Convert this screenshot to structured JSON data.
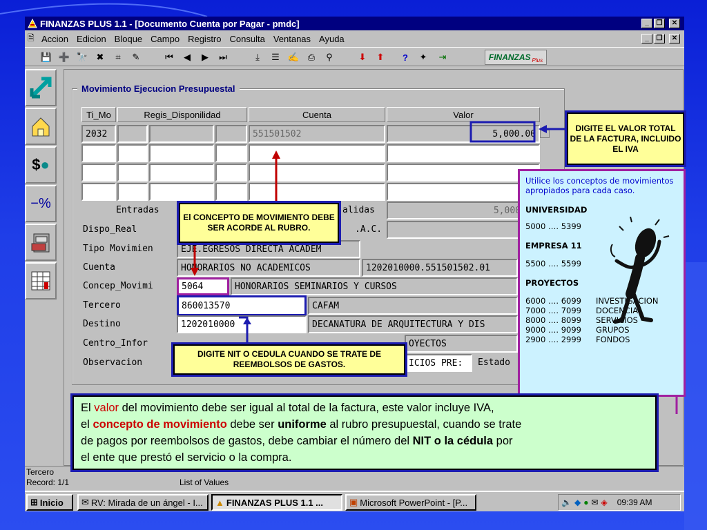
{
  "window": {
    "title": "FINANZAS PLUS 1.1 - [Documento Cuenta por Pagar - pmdc]",
    "menu": [
      "Accion",
      "Edicion",
      "Bloque",
      "Campo",
      "Registro",
      "Consulta",
      "Ventanas",
      "Ayuda"
    ],
    "logo": "FINANZAS",
    "logo_sub": "Plus"
  },
  "group_title": "Movimiento Ejecucion Presupuestal",
  "grid": {
    "headers": [
      "Ti_Mo",
      "Regis_Disponilidad",
      "Cuenta",
      "Valor"
    ],
    "row1": {
      "ti_mo": "2032",
      "cuenta": "551501502",
      "valor": "5,000.00"
    }
  },
  "form": {
    "entradas_label": "Entradas",
    "salidas_label": "alidas",
    "salidas_value": "5,000",
    "dispo_real_label": "Dispo_Real",
    "iac_label": ".A.C.",
    "tipo_label": "Tipo Movimien",
    "tipo_value": "EJE.EGRESOS DIRECTA ACADEM",
    "cuenta_label": "Cuenta",
    "cuenta_name": "HONORARIOS NO ACADEMICOS",
    "cuenta_code": "1202010000.551501502.01",
    "concep_label": "Concep_Movimi",
    "concep_code": "5064",
    "concep_desc": "HONORARIOS SEMINARIOS Y CURSOS",
    "tercero_label": "Tercero",
    "tercero_value": "860013570",
    "tercero_name": "CAFAM",
    "destino_label": "Destino",
    "destino_value": "1202010000",
    "destino_desc": "DECANATURA DE ARQUITECTURA Y DIS",
    "centro_label": "Centro_Infor",
    "centro_desc": "OYECTOS",
    "obs_label": "Observacion",
    "obs_value": "ICIOS PRE:",
    "estado_label": "Estado"
  },
  "status": {
    "line1": "Tercero",
    "line2": "Record: 1/1",
    "lov": "List of Values"
  },
  "taskbar": {
    "start": "Inicio",
    "tasks": [
      "RV: Mirada de un ángel - I...",
      "FINANZAS PLUS 1.1 ...",
      "Microsoft PowerPoint - [P..."
    ],
    "clock": "09:39 AM"
  },
  "callouts": {
    "valor": "DIGITE EL VALOR TOTAL DE LA FACTURA, INCLUIDO EL IVA",
    "concepto": "El CONCEPTO DE MOVIMIENTO DEBE SER ACORDE AL RUBRO.",
    "nit": "DIGITE NIT O CEDULA CUANDO SE TRATE DE REEMBOLSOS DE GASTOS."
  },
  "concepts": {
    "intro1": "Utilice los conceptos de movimientos",
    "intro2": "apropiados para cada caso.",
    "universidad": "UNIVERSIDAD",
    "universidad_range": "5000 …. 5399",
    "empresa": "EMPRESA 11",
    "empresa_range": "5500 …. 5599",
    "proyectos": "PROYECTOS",
    "proyectos_rows": [
      {
        "range": "6000 …. 6099",
        "name": "INVESTIGACION"
      },
      {
        "range": "7000 …. 7099",
        "name": "DOCENCIA"
      },
      {
        "range": "8000 …. 8099",
        "name": "SERVICIOS"
      },
      {
        "range": "9000 …. 9099",
        "name": "GRUPOS"
      },
      {
        "range": "2900 …. 2999",
        "name": "FONDOS"
      }
    ]
  },
  "note": {
    "p1a": "El ",
    "p1b": "valor",
    "p1c": " del movimiento debe ser igual al total de la factura, este valor incluye IVA,",
    "p2a": "el ",
    "p2b": "concepto de movimiento",
    "p2c": " debe ser ",
    "p2d": "uniforme",
    "p2e": " al rubro presupuestal, cuando se trate",
    "p3a": "de pagos por reembolsos de gastos, debe cambiar el número del ",
    "p3b": "NIT o la cédula",
    "p3c": " por",
    "p4": "el ente que prestó el servicio o la compra."
  }
}
